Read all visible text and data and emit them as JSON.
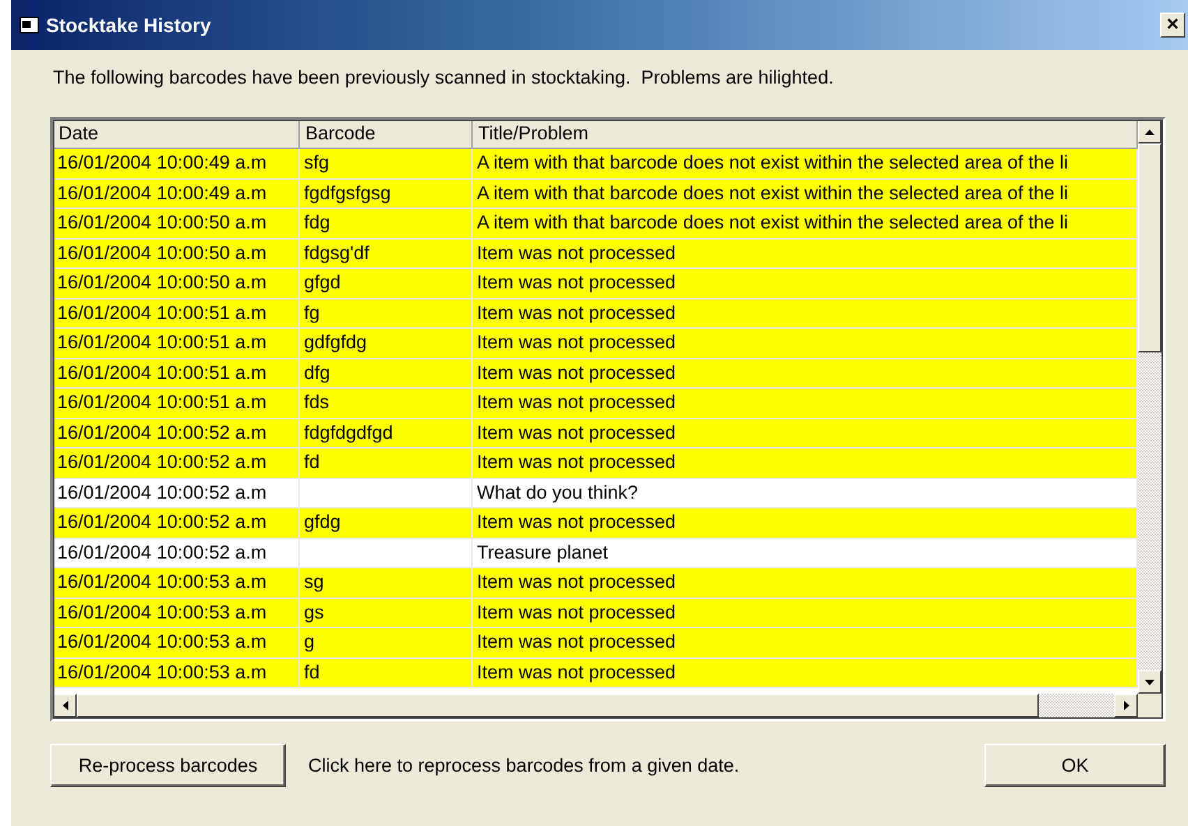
{
  "window": {
    "title": "Stocktake History",
    "close": "×"
  },
  "description": "The following barcodes have been previously scanned in stocktaking.  Problems are hilighted.",
  "table": {
    "columns": [
      "Date",
      "Barcode",
      "Title/Problem"
    ],
    "rows": [
      {
        "date": "16/01/2004 10:00:49 a.m",
        "barcode": "sfg",
        "title": "A item with that barcode does not exist within the selected area of the li",
        "highlighted": true
      },
      {
        "date": "16/01/2004 10:00:49 a.m",
        "barcode": "fgdfgsfgsg",
        "title": "A item with that barcode does not exist within the selected area of the li",
        "highlighted": true
      },
      {
        "date": "16/01/2004 10:00:50 a.m",
        "barcode": "fdg",
        "title": "A item with that barcode does not exist within the selected area of the li",
        "highlighted": true
      },
      {
        "date": "16/01/2004 10:00:50 a.m",
        "barcode": "fdgsg'df",
        "title": "Item was not processed",
        "highlighted": true
      },
      {
        "date": "16/01/2004 10:00:50 a.m",
        "barcode": "gfgd",
        "title": "Item was not processed",
        "highlighted": true
      },
      {
        "date": "16/01/2004 10:00:51 a.m",
        "barcode": "fg",
        "title": "Item was not processed",
        "highlighted": true
      },
      {
        "date": "16/01/2004 10:00:51 a.m",
        "barcode": "gdfgfdg",
        "title": "Item was not processed",
        "highlighted": true
      },
      {
        "date": "16/01/2004 10:00:51 a.m",
        "barcode": "dfg",
        "title": "Item was not processed",
        "highlighted": true
      },
      {
        "date": "16/01/2004 10:00:51 a.m",
        "barcode": "fds",
        "title": "Item was not processed",
        "highlighted": true
      },
      {
        "date": "16/01/2004 10:00:52 a.m",
        "barcode": "fdgfdgdfgd",
        "title": "Item was not processed",
        "highlighted": true
      },
      {
        "date": "16/01/2004 10:00:52 a.m",
        "barcode": "fd",
        "title": "Item was not processed",
        "highlighted": true
      },
      {
        "date": "16/01/2004 10:00:52 a.m",
        "barcode": "",
        "title": "What do you think?",
        "highlighted": false
      },
      {
        "date": "16/01/2004 10:00:52 a.m",
        "barcode": "gfdg",
        "title": "Item was not processed",
        "highlighted": true
      },
      {
        "date": "16/01/2004 10:00:52 a.m",
        "barcode": "",
        "title": "Treasure planet",
        "highlighted": false
      },
      {
        "date": "16/01/2004 10:00:53 a.m",
        "barcode": "sg",
        "title": "Item was not processed",
        "highlighted": true
      },
      {
        "date": "16/01/2004 10:00:53 a.m",
        "barcode": "gs",
        "title": "Item was not processed",
        "highlighted": true
      },
      {
        "date": "16/01/2004 10:00:53 a.m",
        "barcode": "g",
        "title": "Item was not processed",
        "highlighted": true
      },
      {
        "date": "16/01/2004 10:00:53 a.m",
        "barcode": "fd",
        "title": "Item was not processed",
        "highlighted": true
      }
    ]
  },
  "buttons": {
    "reprocess": "Re-process barcodes",
    "hint": "Click here to reprocess barcodes from a given date.",
    "ok": "OK"
  }
}
